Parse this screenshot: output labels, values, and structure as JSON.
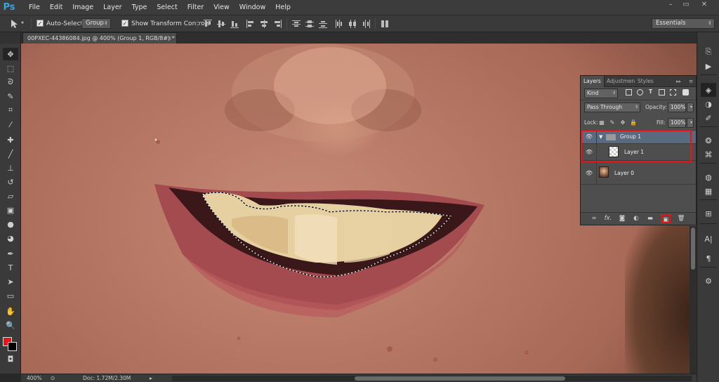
{
  "app": {
    "logo": "Ps"
  },
  "menu": [
    "File",
    "Edit",
    "Image",
    "Layer",
    "Type",
    "Select",
    "Filter",
    "View",
    "Window",
    "Help"
  ],
  "window_controls": {
    "minimize": "–",
    "restore": "▭",
    "close": "✕"
  },
  "options_bar": {
    "auto_select_label": "Auto-Select:",
    "auto_select_checked": true,
    "auto_select_target": "Group",
    "show_transform_label": "Show Transform Controls",
    "show_transform_checked": true,
    "workspace": "Essentials"
  },
  "document": {
    "tab_title": "00PXEC-44386084.jpg @ 400% (Group 1, RGB/8#) *",
    "close_glyph": "×"
  },
  "layers_panel": {
    "tabs": [
      "Layers",
      "Adjustmen",
      "Styles"
    ],
    "active_tab": "Layers",
    "filter_kind": "Kind",
    "blend_mode": "Pass Through",
    "opacity_label": "Opacity:",
    "opacity_value": "100%",
    "lock_label": "Lock:",
    "fill_label": "Fill:",
    "fill_value": "100%",
    "layers": [
      {
        "name": "Group 1",
        "type": "group",
        "visible": true,
        "selected": true
      },
      {
        "name": "Layer 1",
        "type": "transparent-layer",
        "visible": true,
        "selected": false
      },
      {
        "name": "Layer 0",
        "type": "photo-layer",
        "visible": true,
        "selected": false
      }
    ],
    "footer_icons": [
      "link-icon",
      "fx-icon",
      "mask-icon",
      "adjustment-icon",
      "folder-icon",
      "new-layer-icon",
      "trash-icon"
    ],
    "fx_label": "fx."
  },
  "status": {
    "zoom": "400%",
    "doc_size": "Doc: 1.72M/2.30M"
  },
  "colors": {
    "foreground": "#e11111",
    "background": "#000000",
    "highlight": "#e11111",
    "selected_row": "#5a6a7e"
  }
}
